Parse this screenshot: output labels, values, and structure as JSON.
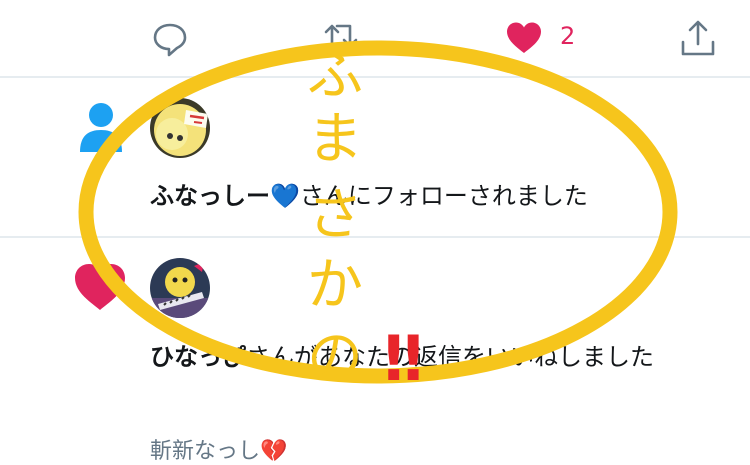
{
  "tweet_actions": {
    "reply_icon": "speech-bubble-outline",
    "retweet_icon": "retweet-arrows",
    "like_icon": "heart-filled",
    "like_count": "2",
    "share_icon": "share-upload"
  },
  "notifications": [
    {
      "type_icon": "person-follow",
      "user_name": "ふなっしー",
      "user_emoji": "💙",
      "action_text": "さんにフォローされました"
    },
    {
      "type_icon": "heart-like",
      "user_name": "ひなっぴ",
      "action_text": "さんがあなたの返信をいいねしました",
      "quoted_text": "斬新なっし💔"
    }
  ],
  "overlay_annotation": {
    "text_chars": [
      "ふ",
      "ま",
      "さ",
      "か",
      "の"
    ],
    "exclaim": "‼",
    "color": "#f6c51c",
    "exclaim_color": "#e8252a"
  },
  "colors": {
    "like": "#e0245e",
    "follow": "#1da1f2",
    "icon_gray": "#657786",
    "divider": "#e6ecf0"
  }
}
